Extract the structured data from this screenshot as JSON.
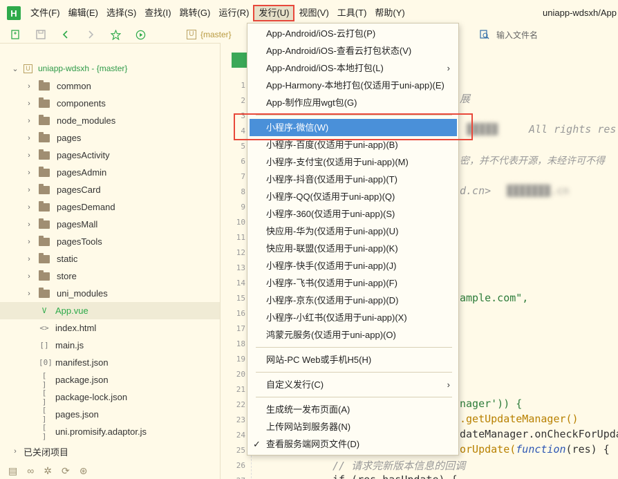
{
  "app": {
    "logo_letter": "H",
    "window_title": "uniapp-wdsxh/App"
  },
  "menubar": {
    "items": [
      "文件(F)",
      "编辑(E)",
      "选择(S)",
      "查找(I)",
      "跳转(G)",
      "运行(R)",
      "发行(U)",
      "视图(V)",
      "工具(T)",
      "帮助(Y)"
    ]
  },
  "toolbar": {
    "branch": "{master}",
    "file_search_placeholder": "输入文件名"
  },
  "sidebar": {
    "project": "uniapp-wdsxh - {master}",
    "folders": [
      "common",
      "components",
      "node_modules",
      "pages",
      "pagesActivity",
      "pagesAdmin",
      "pagesCard",
      "pagesDemand",
      "pagesMall",
      "pagesTools",
      "static",
      "store",
      "uni_modules"
    ],
    "files": [
      {
        "icon": "V",
        "name": "App.vue"
      },
      {
        "icon": "<>",
        "name": "index.html"
      },
      {
        "icon": "[]",
        "name": "main.js"
      },
      {
        "icon": "[0]",
        "name": "manifest.json"
      },
      {
        "icon": "[ ]",
        "name": "package.json"
      },
      {
        "icon": "[ ]",
        "name": "package-lock.json"
      },
      {
        "icon": "[ ]",
        "name": "pages.json"
      },
      {
        "icon": "[ ]",
        "name": "uni.promisify.adaptor.js"
      }
    ],
    "closed_projects": "已关闭项目"
  },
  "editor": {
    "line_numbers": [
      "1",
      "2",
      "3",
      "4",
      "5",
      "6",
      "7",
      "8",
      "9",
      "10",
      "11",
      "12",
      "13",
      "14",
      "15",
      "16",
      "17",
      "18",
      "19",
      "20",
      "21",
      "22",
      "23",
      "24",
      "25",
      "26",
      "27"
    ],
    "snippets": {
      "line2": "展",
      "line4": "All rights res",
      "line6": "密，并不代表开源，未经许可不得",
      "line8": "d.cn>",
      "line15": "ample.com\",",
      "line22": "nager')) {",
      "line23": ".getUpdateManager()",
      "line24": "dateManager.onCheckForUpdat",
      "line25a": "orUpdate(",
      "line25b": "function",
      "line25c": "(res) {",
      "line26": "// 请求完新版本信息的回调",
      "line27": "if (res.hasUpdate) {"
    }
  },
  "dropdown": {
    "group1": [
      "App-Android/iOS-云打包(P)",
      "App-Android/iOS-查看云打包状态(V)",
      "App-Android/iOS-本地打包(L)",
      "App-Harmony-本地打包(仅适用于uni-app)(E)",
      "App-制作应用wgt包(G)"
    ],
    "group2": [
      "小程序-微信(W)",
      "小程序-百度(仅适用于uni-app)(B)",
      "小程序-支付宝(仅适用于uni-app)(M)",
      "小程序-抖音(仅适用于uni-app)(T)",
      "小程序-QQ(仅适用于uni-app)(Q)",
      "小程序-360(仅适用于uni-app)(S)",
      "快应用-华为(仅适用于uni-app)(U)",
      "快应用-联盟(仅适用于uni-app)(K)",
      "小程序-快手(仅适用于uni-app)(J)",
      "小程序-飞书(仅适用于uni-app)(F)",
      "小程序-京东(仅适用于uni-app)(D)",
      "小程序-小红书(仅适用于uni-app)(X)",
      "鸿蒙元服务(仅适用于uni-app)(O)"
    ],
    "group3": [
      "网站-PC Web或手机H5(H)"
    ],
    "group4": [
      "自定义发行(C)"
    ],
    "group5": [
      "生成统一发布页面(A)",
      "上传网站到服务器(N)",
      "查看服务端网页文件(D)"
    ],
    "highlighted": "小程序-微信(W)",
    "checked": "查看服务端网页文件(D)"
  },
  "colors": {
    "accent_green": "#2eaa4a",
    "highlight_blue": "#4a90d9",
    "callout_red": "#e8483a",
    "background": "#fffae8"
  }
}
